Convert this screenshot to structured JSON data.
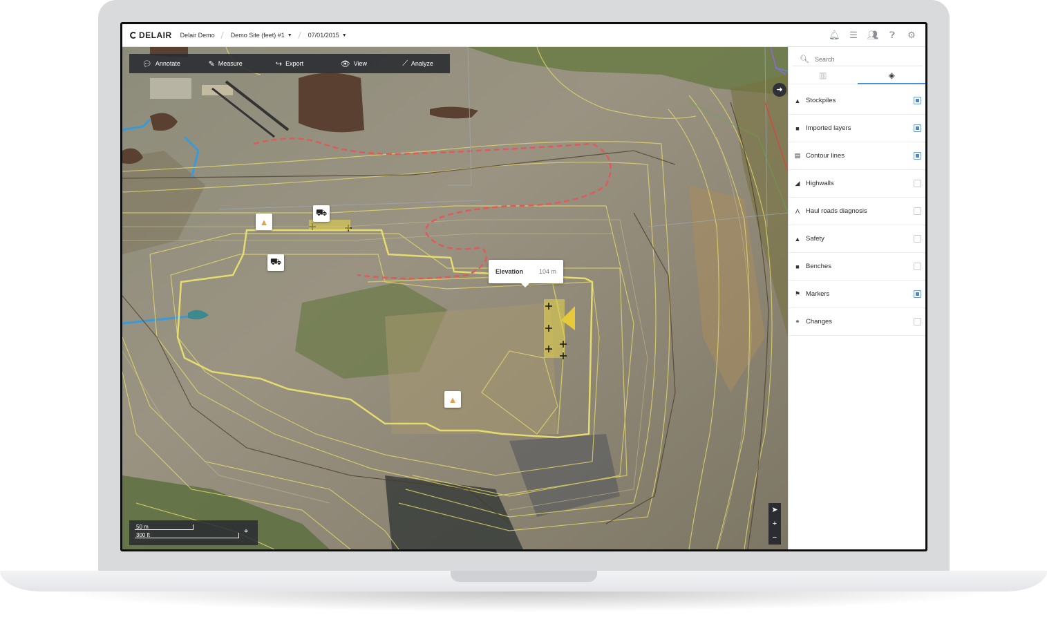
{
  "header": {
    "logo": "DELAIR",
    "project": "Delair Demo",
    "site": "Demo Site (feet) #1",
    "date": "07/01/2015"
  },
  "header_icons": [
    "bell-icon",
    "list-icon",
    "users-icon",
    "help-icon",
    "gear-icon"
  ],
  "toolbar": {
    "annotate": "Annotate",
    "measure": "Measure",
    "export": "Export",
    "view": "View",
    "analyze": "Analyze"
  },
  "tooltip": {
    "label": "Elevation",
    "value": "104 m"
  },
  "scale": {
    "metric": "50 m",
    "imperial": "300 ft"
  },
  "panel": {
    "search_placeholder": "Search",
    "tabs": [
      "map-icon",
      "layers-icon"
    ],
    "active_tab": "layers",
    "layers": [
      {
        "label": "Stockpiles",
        "icon": "stockpile-icon",
        "checked": true
      },
      {
        "label": "Imported layers",
        "icon": "folder-icon",
        "checked": true
      },
      {
        "label": "Contour lines",
        "icon": "contour-icon",
        "checked": true
      },
      {
        "label": "Highwalls",
        "icon": "highwall-icon",
        "checked": false
      },
      {
        "label": "Haul roads diagnosis",
        "icon": "road-icon",
        "checked": false
      },
      {
        "label": "Safety",
        "icon": "cone-icon",
        "checked": false
      },
      {
        "label": "Benches",
        "icon": "folder-icon",
        "checked": false
      },
      {
        "label": "Markers",
        "icon": "marker-icon",
        "checked": true
      },
      {
        "label": "Changes",
        "icon": "changes-icon",
        "checked": false
      }
    ]
  },
  "colors": {
    "accent": "#4a86d6",
    "contour": "#e8dc6a",
    "haul_road": "#e05a5a",
    "water": "#3a9ad9"
  }
}
